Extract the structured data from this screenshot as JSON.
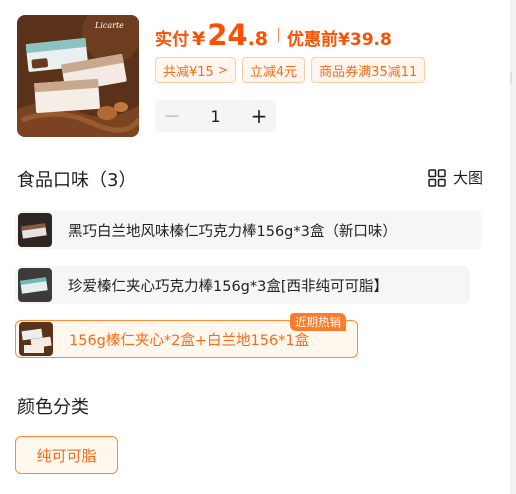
{
  "price": {
    "actual_label": "实付",
    "currency": "¥",
    "integer": "24",
    "decimal": ".8",
    "original_label": "优惠前",
    "original_price": "¥39.8"
  },
  "promo_tags": [
    {
      "label": "共减¥15",
      "chevron": ">"
    },
    {
      "label": "立减4元"
    },
    {
      "label": "商品券满35减11"
    }
  ],
  "quantity": {
    "minus": "－",
    "value": "1",
    "plus": "+"
  },
  "flavor_section": {
    "title": "食品口味（3）",
    "big_view_label": "大图",
    "options": [
      {
        "label": "黑巧白兰地风味榛仁巧克力棒156g*3盒（新口味）",
        "selected": false
      },
      {
        "label": "珍爱榛仁夹心巧克力棒156g*3盒[西非纯可可脂】",
        "selected": false
      },
      {
        "label": "156g榛仁夹心*2盒+白兰地156*1盒",
        "selected": true,
        "badge": "近期热销"
      }
    ]
  },
  "color_section": {
    "title": "颜色分类",
    "options": [
      {
        "label": "纯可可脂",
        "selected": true
      }
    ]
  },
  "icons": {
    "product_thumbnail": "chocolate-box-icon",
    "big_view": "grid-four-icon"
  },
  "colors": {
    "accent": "#ff4f00",
    "accent_light": "#ff8a30",
    "tag_bg": "#fff7ef"
  }
}
